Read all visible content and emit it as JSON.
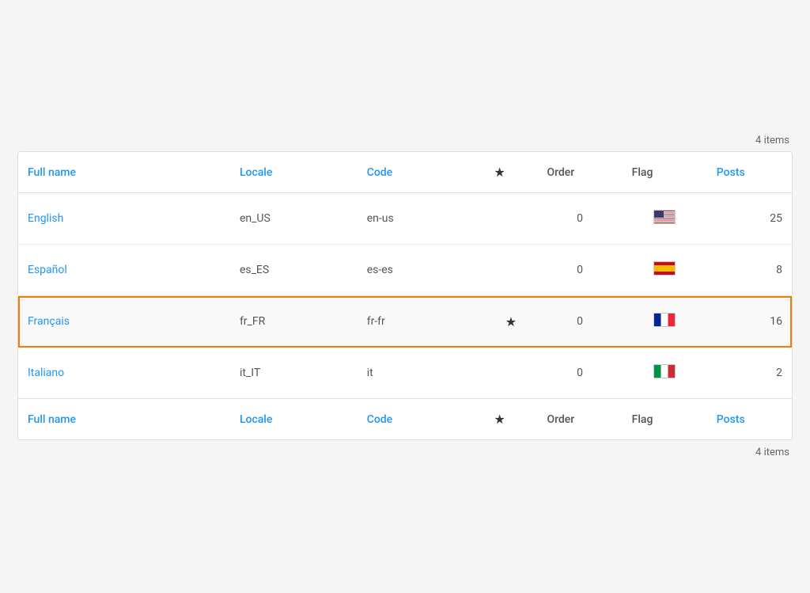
{
  "page": {
    "items_count_top": "4 items",
    "items_count_bottom": "4 items"
  },
  "table": {
    "header": {
      "full_name": "Full name",
      "locale": "Locale",
      "code": "Code",
      "star": "★",
      "order": "Order",
      "flag": "Flag",
      "posts": "Posts"
    },
    "footer": {
      "full_name": "Full name",
      "locale": "Locale",
      "code": "Code",
      "star": "★",
      "order": "Order",
      "flag": "Flag",
      "posts": "Posts"
    },
    "rows": [
      {
        "id": "english",
        "full_name": "English",
        "locale": "en_US",
        "code": "en-us",
        "star": "",
        "order": "0",
        "flag_type": "us",
        "posts": "25",
        "highlighted": false
      },
      {
        "id": "espanol",
        "full_name": "Español",
        "locale": "es_ES",
        "code": "es-es",
        "star": "",
        "order": "0",
        "flag_type": "es",
        "posts": "8",
        "highlighted": false
      },
      {
        "id": "francais",
        "full_name": "Français",
        "locale": "fr_FR",
        "code": "fr-fr",
        "star": "★",
        "order": "0",
        "flag_type": "fr",
        "posts": "16",
        "highlighted": true
      },
      {
        "id": "italiano",
        "full_name": "Italiano",
        "locale": "it_IT",
        "code": "it",
        "star": "",
        "order": "0",
        "flag_type": "it",
        "posts": "2",
        "highlighted": false
      }
    ]
  }
}
